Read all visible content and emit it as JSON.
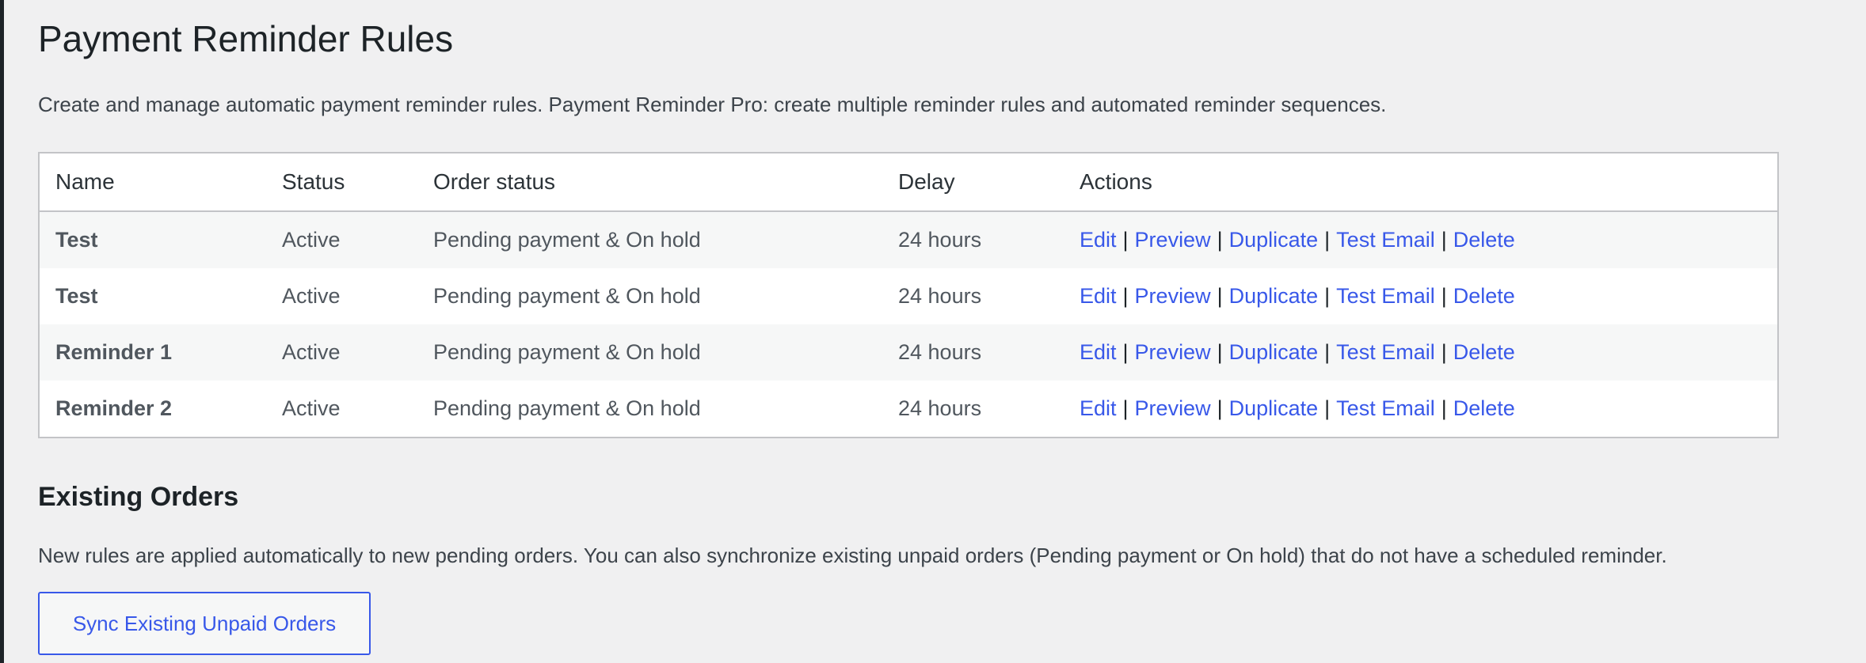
{
  "page": {
    "title": "Payment Reminder Rules",
    "intro": "Create and manage automatic payment reminder rules. Payment Reminder Pro: create multiple reminder rules and automated reminder sequences."
  },
  "rules_table": {
    "headers": {
      "name": "Name",
      "status": "Status",
      "order_status": "Order status",
      "delay": "Delay",
      "actions": "Actions"
    },
    "action_labels": {
      "edit": "Edit",
      "preview": "Preview",
      "duplicate": "Duplicate",
      "test_email": "Test Email",
      "delete": "Delete",
      "separator": "|"
    },
    "rows": [
      {
        "name": "Test",
        "status": "Active",
        "order_status": "Pending payment & On hold",
        "delay": "24 hours"
      },
      {
        "name": "Test",
        "status": "Active",
        "order_status": "Pending payment & On hold",
        "delay": "24 hours"
      },
      {
        "name": "Reminder 1",
        "status": "Active",
        "order_status": "Pending payment & On hold",
        "delay": "24 hours"
      },
      {
        "name": "Reminder 2",
        "status": "Active",
        "order_status": "Pending payment & On hold",
        "delay": "24 hours"
      }
    ]
  },
  "existing_orders": {
    "title": "Existing Orders",
    "description": "New rules are applied automatically to new pending orders. You can also synchronize existing unpaid orders (Pending payment or On hold) that do not have a scheduled reminder.",
    "sync_button": "Sync Existing Unpaid Orders"
  },
  "colors": {
    "link": "#3858e9",
    "background": "#f0f0f1",
    "row_alt": "#f6f7f7"
  }
}
